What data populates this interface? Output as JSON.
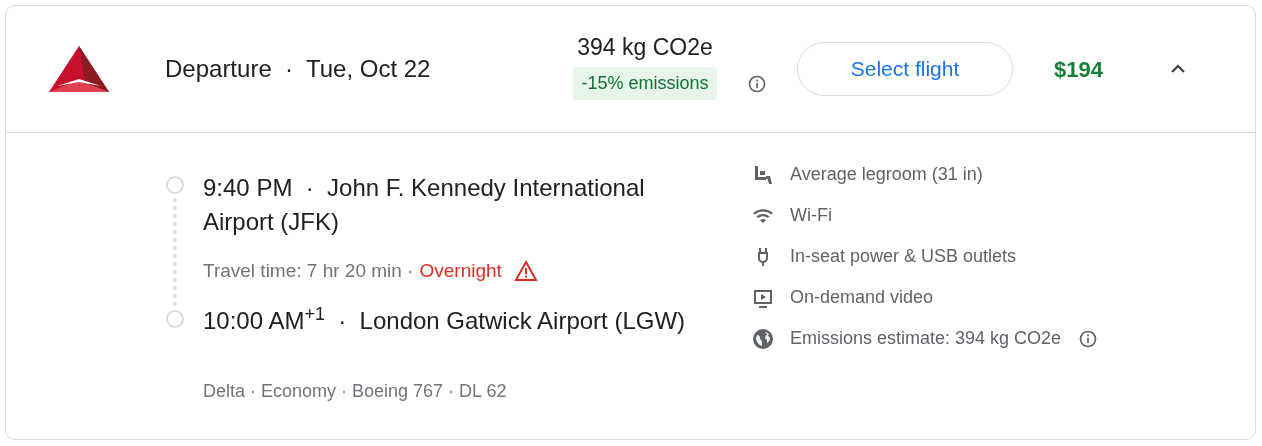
{
  "header": {
    "title": "Departure  ·  Tue, Oct 22",
    "emissions": "394 kg CO2e",
    "emissions_badge": "-15% emissions",
    "button": "Select flight",
    "price": "$194",
    "expanded": true
  },
  "itinerary": {
    "departure": "9:40 PM  ·  John F. Kennedy International Airport (JFK)",
    "travel_time": "Travel time: 7 hr 20 min ·",
    "warning": "Overnight",
    "arrival": "10:00 AM$^{+1}$  ·  London Gatwick Airport (LGW)",
    "details": "Delta · Economy · Boeing 767 · DL 62"
  },
  "amenities": [
    {
      "kind": "legroom",
      "label": "Average legroom (31 in)",
      "info": false
    },
    {
      "kind": "wifi",
      "label": "Wi-Fi",
      "info": false
    },
    {
      "kind": "power",
      "label": "In-seat power & USB outlets",
      "info": false
    },
    {
      "kind": "video",
      "label": "On-demand video",
      "info": false
    },
    {
      "kind": "emissions",
      "label": "Emissions estimate: 394 kg CO2e",
      "info": true
    }
  ]
}
